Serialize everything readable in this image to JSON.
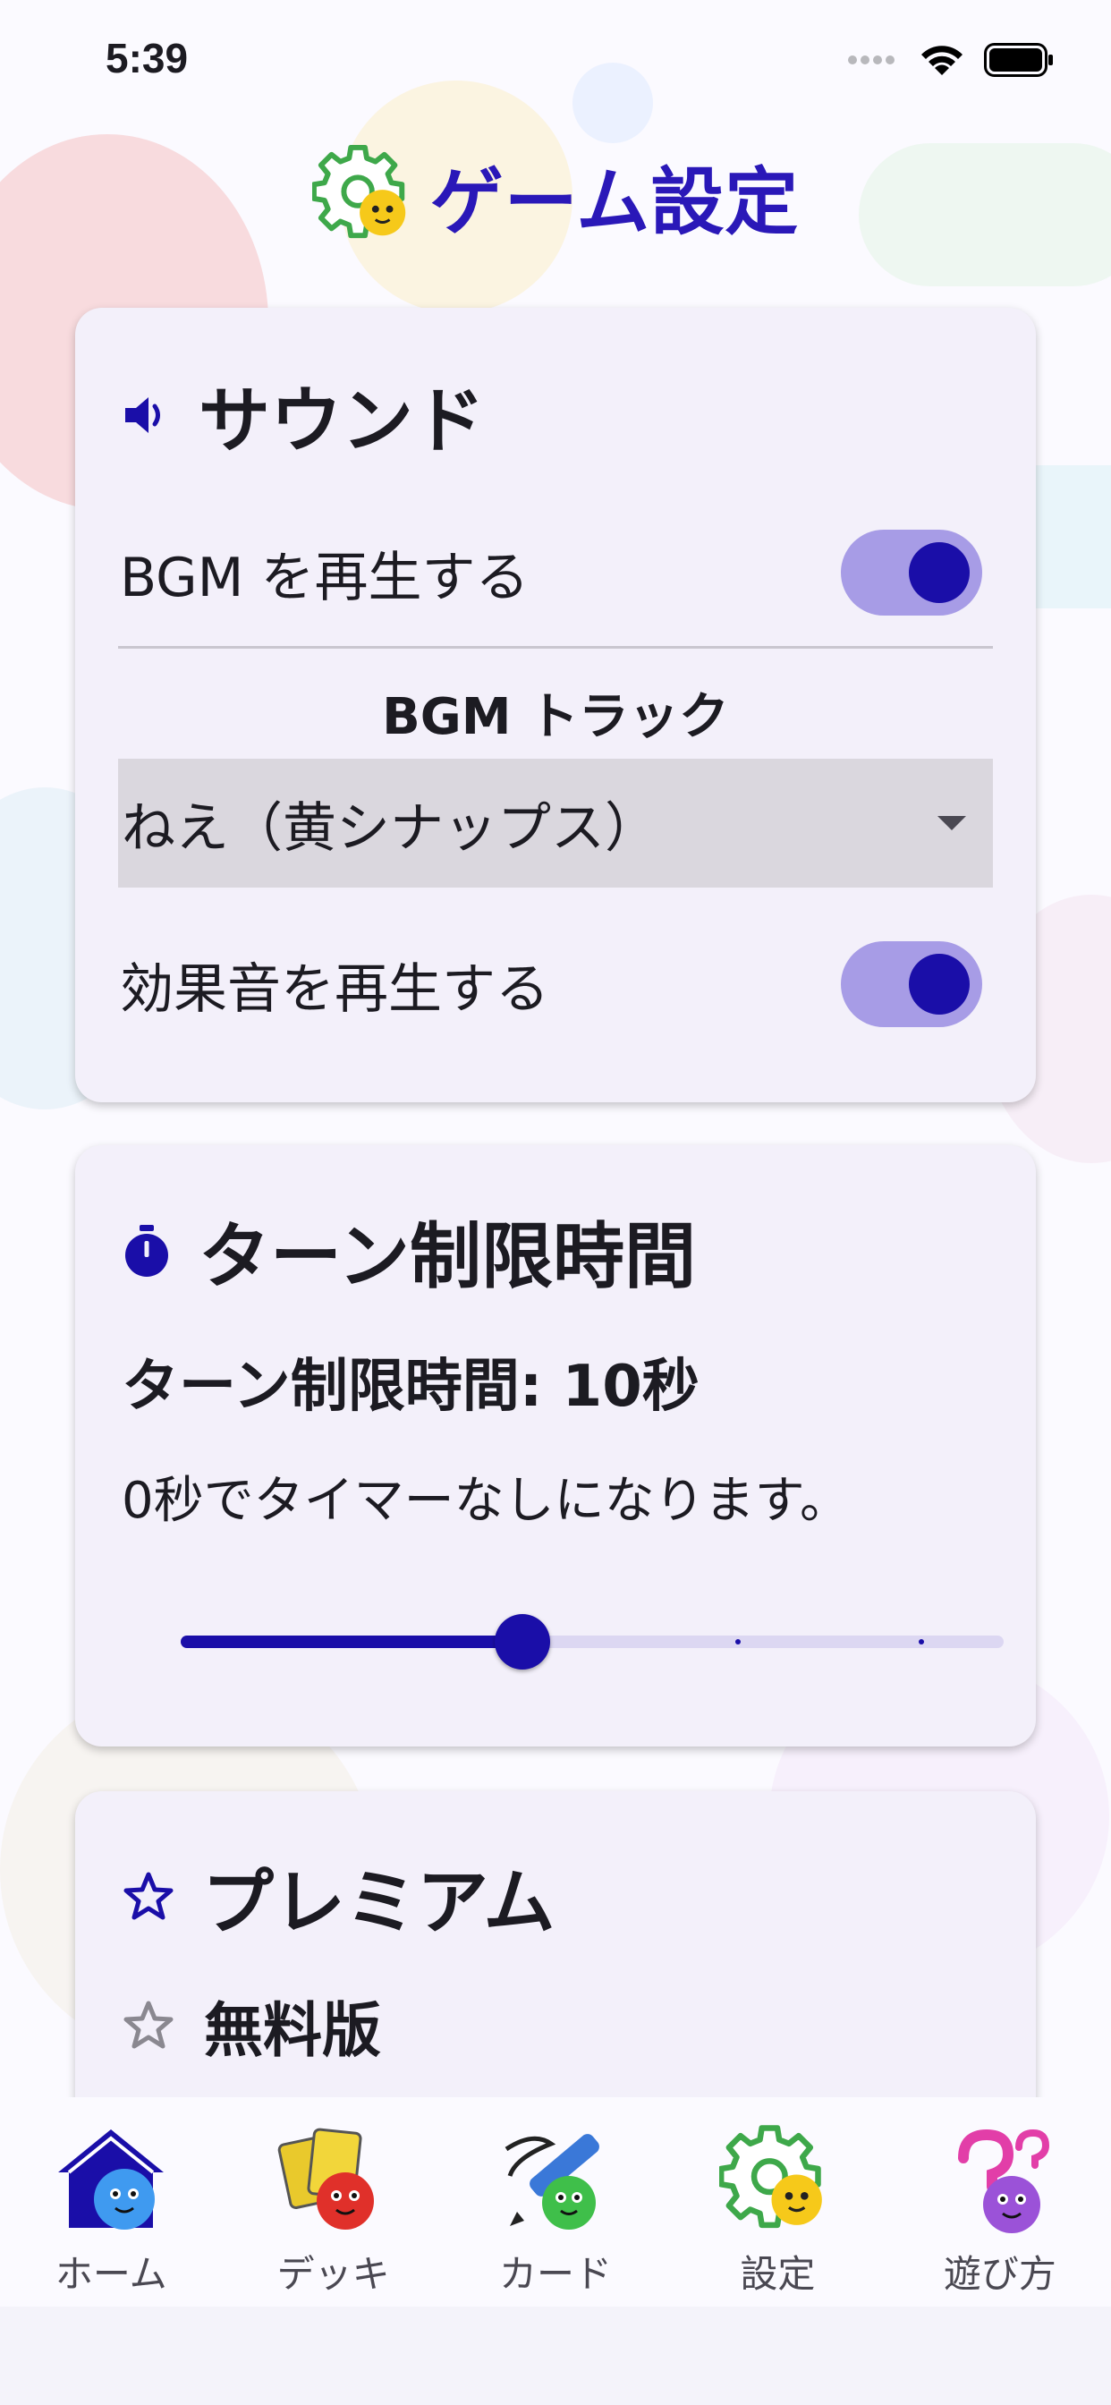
{
  "status_bar": {
    "time": "5:39"
  },
  "header": {
    "title": "ゲーム設定",
    "icon": "gear-mascot-icon"
  },
  "sound": {
    "title": "サウンド",
    "icon": "speaker-icon",
    "bgm_label": "BGM を再生する",
    "bgm_enabled": true,
    "track_label": "BGM トラック",
    "track_value": "ねえ（黄シナップス）",
    "sfx_label": "効果音を再生する",
    "sfx_enabled": true
  },
  "turn_limit": {
    "title": "ターン制限時間",
    "icon": "stopwatch-icon",
    "value_label": "ターン制限時間: 10秒",
    "description": "0秒でタイマーなしになります。",
    "slider_fraction": 0.5
  },
  "premium": {
    "title": "プレミアム",
    "icon": "star-outline-icon",
    "status": "無料版"
  },
  "tabs": [
    {
      "label": "ホーム",
      "icon": "home-mascot-icon"
    },
    {
      "label": "デッキ",
      "icon": "cards-mascot-icon"
    },
    {
      "label": "カード",
      "icon": "pen-mascot-icon"
    },
    {
      "label": "設定",
      "icon": "gear-mascot-icon"
    },
    {
      "label": "遊び方",
      "icon": "question-mascot-icon"
    }
  ],
  "colors": {
    "accent": "#1a0ea8",
    "title": "#2a18b8",
    "toggle_track": "#a79ce6",
    "card_bg": "#f3f0fa"
  }
}
